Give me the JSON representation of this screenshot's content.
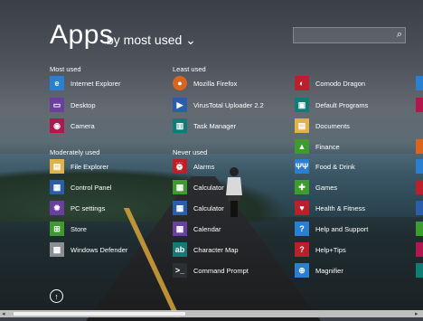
{
  "header": {
    "title": "Apps",
    "sort_label": "by most used",
    "sort_chevron": "⌄",
    "search_placeholder": ""
  },
  "groups": [
    {
      "label": "Most used"
    },
    {
      "label": "Moderately used"
    },
    {
      "label": "Least used"
    },
    {
      "label": "Never used"
    }
  ],
  "apps": {
    "col1": [
      "Internet Explorer",
      "Desktop",
      "Camera",
      "File Explorer",
      "Control Panel",
      "PC settings",
      "Store",
      "Windows Defender"
    ],
    "col2": [
      "Mozilla Firefox",
      "VirusTotal Uploader 2.2",
      "Task Manager",
      "Alarms",
      "Calculator",
      "Calculator",
      "Calendar",
      "Character Map",
      "Command Prompt"
    ],
    "col3": [
      "Comodo Dragon",
      "Default Programs",
      "Documents",
      "Finance",
      "Food & Drink",
      "Games",
      "Health & Fitness",
      "Help and Support",
      "Help+Tips",
      "Magnifier"
    ]
  },
  "icons": {
    "search": "⌕",
    "scroll_up": "↑",
    "scroll_left": "◂",
    "scroll_right": "▸"
  },
  "colors": {
    "accent_blue": "#1e73be",
    "tile_green": "#3e9b2d",
    "tile_red": "#b9202b"
  }
}
